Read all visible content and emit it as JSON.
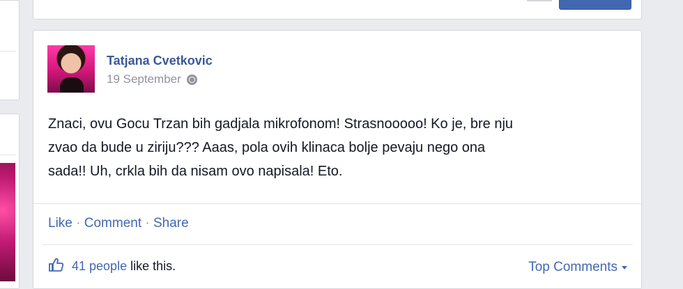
{
  "post": {
    "author": "Tatjana Cvetkovic",
    "date": "19 September",
    "privacy_icon": "globe-icon",
    "text_lines": [
      "Znaci, ovu Gocu Trzan bih gadjala mikrofonom! Strasnooooo! Ko je, bre nju",
      "zvao da bude u ziriju??? Aaas, pola ovih klinaca bolje pevaju nego ona",
      "sada!! Uh, crkla bih da nisam ovo napisala! Eto."
    ],
    "actions": {
      "like": "Like",
      "comment": "Comment",
      "share": "Share",
      "separator": "·"
    },
    "likes": {
      "icon": "thumbs-up-icon",
      "count_text": "41 people",
      "suffix": "like this."
    },
    "top_comments": "Top Comments"
  },
  "colors": {
    "link": "#4267b2",
    "author": "#3b5998",
    "meta": "#90949c",
    "background": "#e9ebee"
  }
}
